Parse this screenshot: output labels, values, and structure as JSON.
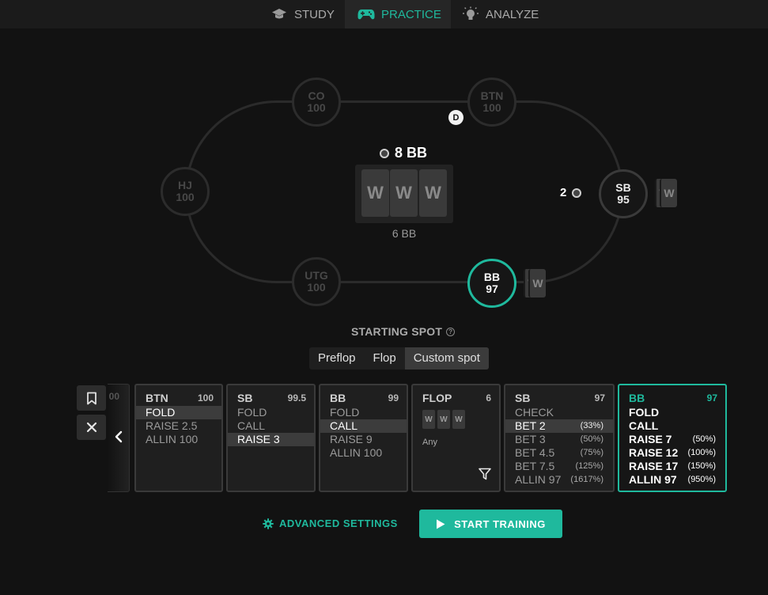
{
  "nav": {
    "tabs": [
      {
        "label": "STUDY",
        "icon": "graduation-cap-icon"
      },
      {
        "label": "PRACTICE",
        "icon": "gamepad-icon"
      },
      {
        "label": "ANALYZE",
        "icon": "lightbulb-icon"
      }
    ],
    "active_tab": "PRACTICE"
  },
  "table": {
    "seats": [
      {
        "pos": "CO",
        "stack": "100"
      },
      {
        "pos": "BTN",
        "stack": "100"
      },
      {
        "pos": "HJ",
        "stack": "100"
      },
      {
        "pos": "SB",
        "stack": "95"
      },
      {
        "pos": "UTG",
        "stack": "100"
      },
      {
        "pos": "BB",
        "stack": "97"
      }
    ],
    "dealer_label": "D",
    "pot": "8 BB",
    "board_cards": [
      "W",
      "W",
      "W"
    ],
    "pot_sub": "6 BB",
    "sb_bet": "2",
    "hole_card_glyph": "W"
  },
  "starting_spot": {
    "title": "STARTING SPOT",
    "info_glyph": "?",
    "options": [
      "Preflop",
      "Flop",
      "Custom spot"
    ],
    "selected": "Custom spot"
  },
  "actions": {
    "partial_stack": "00",
    "cards": [
      {
        "pos": "BTN",
        "stack": "100",
        "rows": [
          {
            "label": "FOLD",
            "selected": true
          },
          {
            "label": "RAISE 2.5"
          },
          {
            "label": "ALLIN 100"
          }
        ]
      },
      {
        "pos": "SB",
        "stack": "99.5",
        "rows": [
          {
            "label": "FOLD"
          },
          {
            "label": "CALL"
          },
          {
            "label": "RAISE 3",
            "selected": true
          }
        ]
      },
      {
        "pos": "BB",
        "stack": "99",
        "rows": [
          {
            "label": "FOLD"
          },
          {
            "label": "CALL",
            "selected": true
          },
          {
            "label": "RAISE 9"
          },
          {
            "label": "ALLIN 100"
          }
        ]
      },
      {
        "pos": "FLOP",
        "stack": "6",
        "cards": [
          "W",
          "W",
          "W"
        ],
        "any": "Any"
      },
      {
        "pos": "SB",
        "stack": "97",
        "rows": [
          {
            "label": "CHECK"
          },
          {
            "label": "BET 2",
            "pct": "(33%)",
            "selected": true
          },
          {
            "label": "BET 3",
            "pct": "(50%)"
          },
          {
            "label": "BET 4.5",
            "pct": "(75%)"
          },
          {
            "label": "BET 7.5",
            "pct": "(125%)"
          },
          {
            "label": "ALLIN 97",
            "pct": "(1617%)"
          }
        ]
      },
      {
        "pos": "BB",
        "stack": "97",
        "rows": [
          {
            "label": "FOLD"
          },
          {
            "label": "CALL"
          },
          {
            "label": "RAISE 7",
            "pct": "(50%)"
          },
          {
            "label": "RAISE 12",
            "pct": "(100%)"
          },
          {
            "label": "RAISE 17",
            "pct": "(150%)"
          },
          {
            "label": "ALLIN 97",
            "pct": "(950%)"
          }
        ]
      }
    ]
  },
  "bottom": {
    "advanced_label": "ADVANCED SETTINGS",
    "start_label": "START TRAINING"
  },
  "colors": {
    "accent": "#1fb99d",
    "background": "#121212"
  }
}
